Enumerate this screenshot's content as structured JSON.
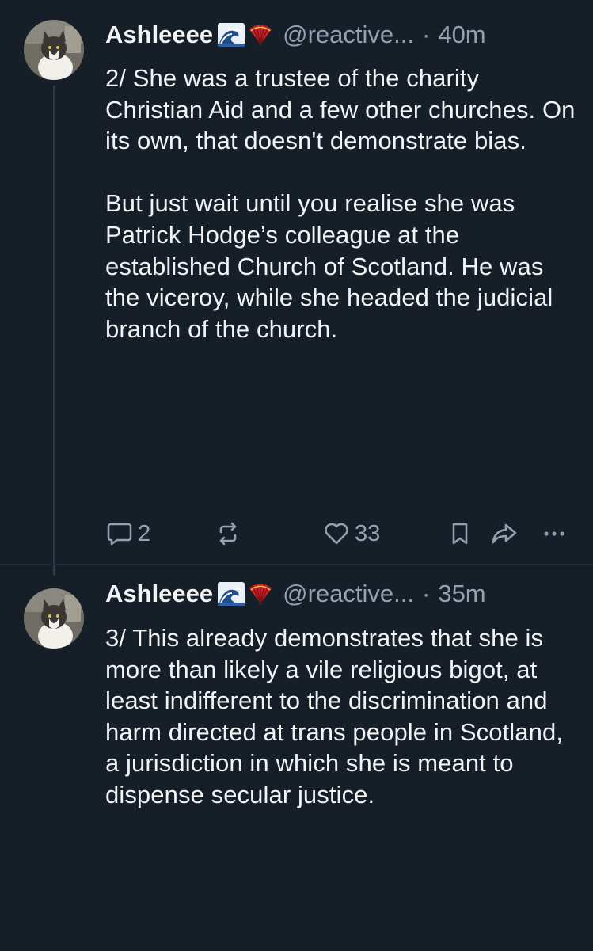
{
  "posts": [
    {
      "author_name": "Ashleeee",
      "flair_icons": [
        "wave-emoji",
        "fan-emoji"
      ],
      "handle": "@reactive...",
      "separator": "·",
      "time": "40m",
      "text": "2/ She was a trustee of the charity Christian Aid and a few other churches. On its own, that doesn't demonstrate bias.\n\nBut just wait until you realise she was Patrick Hodge’s colleague at the established Church of Scotland. He was the viceroy, while she headed the judicial branch of the church.",
      "reply_count": "2",
      "like_count": "33",
      "icons": [
        "reply-icon",
        "repost-icon",
        "heart-icon",
        "bookmark-icon",
        "share-icon",
        "more-icon"
      ]
    },
    {
      "author_name": "Ashleeee",
      "flair_icons": [
        "wave-emoji",
        "fan-emoji"
      ],
      "handle": "@reactive...",
      "separator": "·",
      "time": "35m",
      "text": "3/ This already demonstrates that she is more than likely a vile religious bigot, at least indifferent to the discrimination and harm directed at trans people in Scotland, a jurisdiction in which she is meant to dispense secular justice."
    }
  ],
  "colors": {
    "background": "#161e27",
    "text": "#f1f3f5",
    "muted": "#93a1b1",
    "thread_line": "#2e3a48"
  }
}
